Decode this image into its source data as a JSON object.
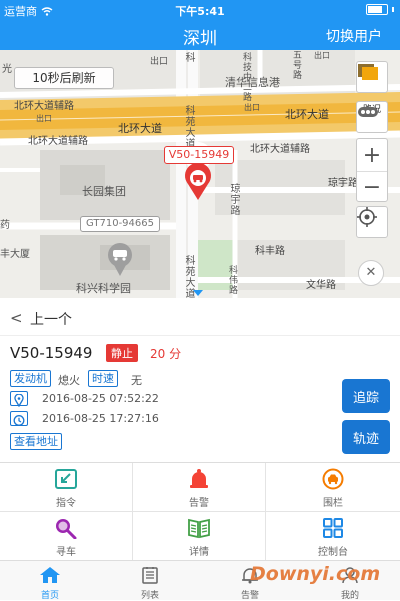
{
  "status_bar": {
    "carrier": "运营商",
    "time": "下午5:41"
  },
  "header": {
    "title": "深圳",
    "action": "切换用户"
  },
  "map": {
    "refresh_label": "10秒后刷新",
    "traffic_label": "路况",
    "zoom_in": "+",
    "zoom_out": "−",
    "close": "✕",
    "selected_vehicle_tag": "V50-15949",
    "other_vehicle_tag": "GT710-94665",
    "labels": {
      "l1": "光",
      "l2": "出口",
      "l3": "科",
      "l4": "科技中二路",
      "l5": "清华信息港",
      "l6": "北环大道辅路",
      "l7": "出口",
      "l8": "北环大道",
      "l9": "出口",
      "l10": "北环大道",
      "l11": "北环大道辅路",
      "l12": "北环大道辅路",
      "l13": "科苑大道",
      "l14": "长园集团",
      "l15": "琼宇路",
      "l16": "琼宇路",
      "l17": "药",
      "l18": "丰大厦",
      "l19": "科苑大道",
      "l20": "科伟路",
      "l21": "科丰路",
      "l22": "文华路",
      "l23": "科兴科学园",
      "l24": "五号路",
      "l25": "出口"
    }
  },
  "detail": {
    "back_label": "上一个",
    "plate": "V50-15949",
    "status": "静止",
    "duration": "20 分",
    "engine_tag": "发动机",
    "engine_value": "熄火",
    "speed_tag": "时速",
    "speed_value": "无",
    "gps_time": "2016-08-25 07:52:22",
    "update_time": "2016-08-25 17:27:16",
    "address_button": "查看地址",
    "track_button": "追踪",
    "trace_button": "轨迹"
  },
  "grid": [
    {
      "label": "指令",
      "icon": "command-icon",
      "color": "#26A69A"
    },
    {
      "label": "告警",
      "icon": "alarm-bell-icon",
      "color": "#F44336"
    },
    {
      "label": "围栏",
      "icon": "fence-car-icon",
      "color": "#F57C00"
    },
    {
      "label": "寻车",
      "icon": "search-car-icon",
      "color": "#9C27B0"
    },
    {
      "label": "详情",
      "icon": "details-book-icon",
      "color": "#43A047"
    },
    {
      "label": "控制台",
      "icon": "console-grid-icon",
      "color": "#1E88E5"
    }
  ],
  "tabs": [
    {
      "label": "首页",
      "icon": "home-icon",
      "active": true
    },
    {
      "label": "列表",
      "icon": "list-icon",
      "active": false
    },
    {
      "label": "告警",
      "icon": "bell-icon",
      "active": false
    },
    {
      "label": "我的",
      "icon": "profile-icon",
      "active": false
    }
  ],
  "watermark": "Downyi.com",
  "colors": {
    "primary": "#2196F3",
    "alert": "#E53935",
    "action": "#1976D2"
  }
}
